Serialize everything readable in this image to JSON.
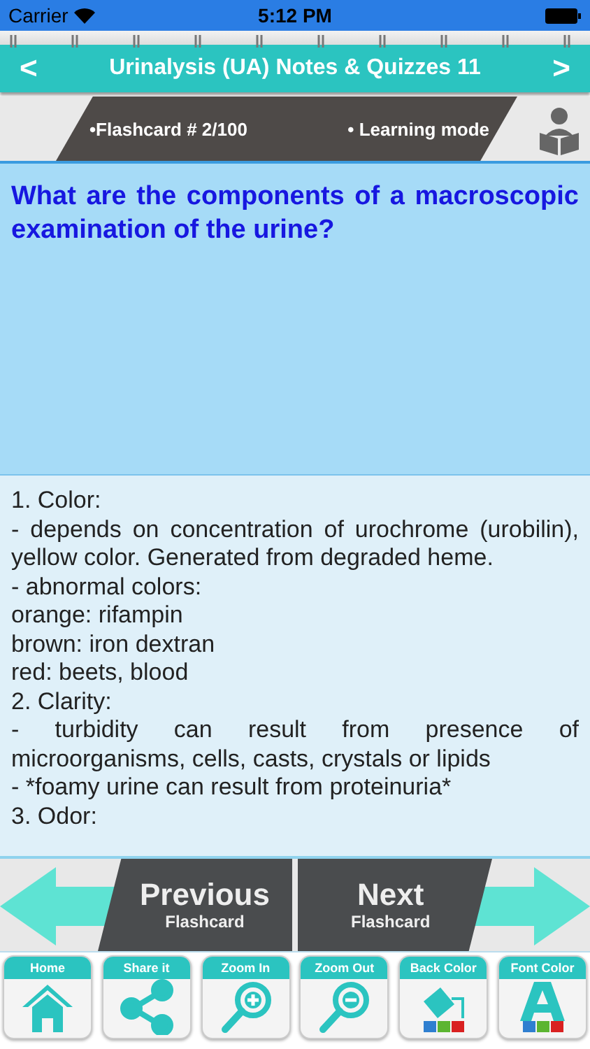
{
  "status_bar": {
    "carrier": "Carrier",
    "time": "5:12 PM"
  },
  "title_bar": {
    "back": "<",
    "title": "Urinalysis (UA) Notes & Quizzes 11",
    "forward": ">"
  },
  "banner": {
    "counter": "•Flashcard #  2/100",
    "mode": "• Learning mode"
  },
  "question": "What are the components of a macroscopic examination of the urine?",
  "answer": [
    {
      "text": "1. Color:",
      "kind": "plain"
    },
    {
      "text": "- depends on concentration of urochrome (urobilin), yellow color. Generated from degraded heme.",
      "kind": "justified"
    },
    {
      "text": "- abnormal colors:",
      "kind": "plain"
    },
    {
      "text": "orange: rifampin",
      "kind": "plain"
    },
    {
      "text": "brown: iron dextran",
      "kind": "plain"
    },
    {
      "text": "red: beets, blood",
      "kind": "plain"
    },
    {
      "text": "2. Clarity:",
      "kind": "plain"
    },
    {
      "text": "- turbidity can result from presence of microorganisms, cells, casts, crystals or lipids",
      "kind": "justified"
    },
    {
      "text": "- *foamy urine can result from proteinuria*",
      "kind": "plain"
    },
    {
      "text": "3. Odor:",
      "kind": "plain"
    }
  ],
  "navigation": {
    "previous": {
      "title": "Previous",
      "subtitle": "Flashcard"
    },
    "next": {
      "title": "Next",
      "subtitle": "Flashcard"
    }
  },
  "toolbar": [
    {
      "label": "Home",
      "kind": "home"
    },
    {
      "label": "Share it",
      "kind": "share"
    },
    {
      "label": "Zoom In",
      "kind": "zoom-in"
    },
    {
      "label": "Zoom Out",
      "kind": "zoom-out"
    },
    {
      "label": "Back Color",
      "kind": "back-color"
    },
    {
      "label": "Font Color",
      "kind": "font-color"
    }
  ]
}
